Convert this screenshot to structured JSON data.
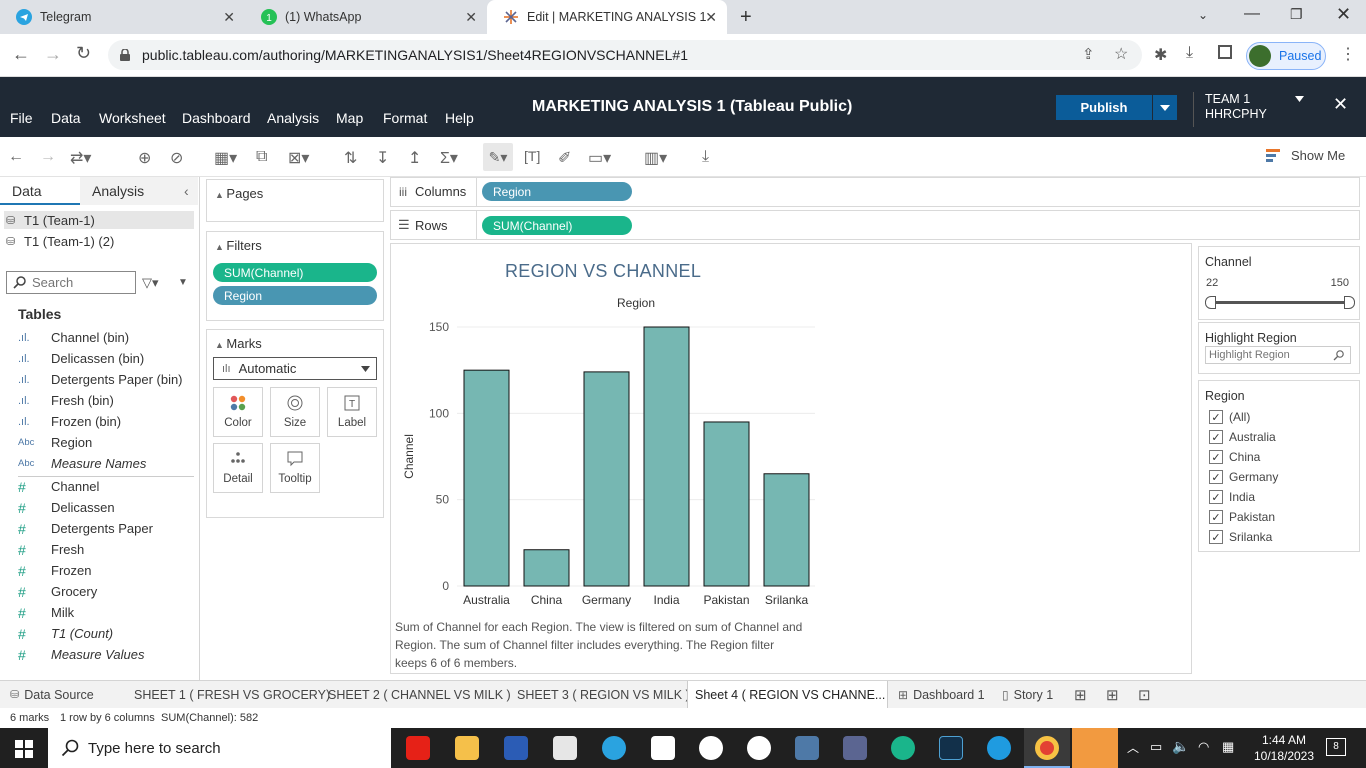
{
  "browser": {
    "tabs": [
      {
        "title": "Telegram",
        "active": false
      },
      {
        "title": "(1) WhatsApp",
        "active": false
      },
      {
        "title": "Edit | MARKETING ANALYSIS 1",
        "active": true
      }
    ],
    "url": "public.tableau.com/authoring/MARKETINGANALYSIS1/Sheet4REGIONVSCHANNEL#1",
    "profile_status": "Paused"
  },
  "app": {
    "menu": [
      "File",
      "Data",
      "Worksheet",
      "Dashboard",
      "Analysis",
      "Map",
      "Format",
      "Help"
    ],
    "title": "MARKETING ANALYSIS 1 (Tableau Public)",
    "publish_label": "Publish",
    "team_line1": "TEAM 1",
    "team_line2": "HHRCPHY",
    "show_me": "Show Me"
  },
  "data_pane": {
    "tab_data": "Data",
    "tab_analysis": "Analysis",
    "sources": [
      "T1 (Team-1)",
      "T1 (Team-1) (2)"
    ],
    "search_placeholder": "Search",
    "tables_label": "Tables",
    "dimensions": [
      {
        "icon": ".ıl.",
        "name": "Channel (bin)",
        "italic": false
      },
      {
        "icon": ".ıl.",
        "name": "Delicassen (bin)",
        "italic": false
      },
      {
        "icon": ".ıl.",
        "name": "Detergents Paper (bin)",
        "italic": false
      },
      {
        "icon": ".ıl.",
        "name": "Fresh (bin)",
        "italic": false
      },
      {
        "icon": ".ıl.",
        "name": "Frozen (bin)",
        "italic": false
      },
      {
        "icon": "Abc",
        "name": "Region",
        "italic": false
      },
      {
        "icon": "Abc",
        "name": "Measure Names",
        "italic": true
      }
    ],
    "measures": [
      {
        "name": "Channel",
        "italic": false
      },
      {
        "name": "Delicassen",
        "italic": false
      },
      {
        "name": "Detergents Paper",
        "italic": false
      },
      {
        "name": "Fresh",
        "italic": false
      },
      {
        "name": "Frozen",
        "italic": false
      },
      {
        "name": "Grocery",
        "italic": false
      },
      {
        "name": "Milk",
        "italic": false
      },
      {
        "name": "T1 (Count)",
        "italic": true
      },
      {
        "name": "Measure Values",
        "italic": true
      }
    ]
  },
  "shelves": {
    "pages_label": "Pages",
    "filters_label": "Filters",
    "filters": [
      "SUM(Channel)",
      "Region"
    ],
    "marks_label": "Marks",
    "mark_type": "Automatic",
    "mark_buttons": [
      "Color",
      "Size",
      "Label",
      "Detail",
      "Tooltip"
    ],
    "columns_label": "Columns",
    "columns_pill": "Region",
    "rows_label": "Rows",
    "rows_pill": "SUM(Channel)"
  },
  "chart_data": {
    "type": "bar",
    "title": "REGION VS CHANNEL",
    "xlabel": "Region",
    "ylabel": "Channel",
    "categories": [
      "Australia",
      "China",
      "Germany",
      "India",
      "Pakistan",
      "Srilanka"
    ],
    "values": [
      125,
      21,
      124,
      150,
      95,
      65
    ],
    "ylim": [
      0,
      150
    ],
    "yticks": [
      0,
      50,
      100,
      150
    ],
    "bar_color": "#76b7b2",
    "grid": true
  },
  "caption": "Sum of Channel for each Region. The view is filtered on sum of Channel and Region. The sum of Channel filter includes everything. The Region filter keeps 6 of 6 members.",
  "right_panel": {
    "channel_title": "Channel",
    "channel_min": "22",
    "channel_max": "150",
    "highlight_title": "Highlight Region",
    "highlight_placeholder": "Highlight Region",
    "region_title": "Region",
    "region_items": [
      "(All)",
      "Australia",
      "China",
      "Germany",
      "India",
      "Pakistan",
      "Srilanka"
    ]
  },
  "sheet_tabs": {
    "data_source": "Data Source",
    "tabs": [
      "SHEET 1 ( FRESH VS GROCERY)",
      "SHEET 2 ( CHANNEL VS MILK )",
      "SHEET 3 ( REGION VS MILK )",
      "Sheet 4 ( REGION VS CHANNE...",
      "Dashboard 1",
      "Story 1"
    ]
  },
  "status": {
    "marks": "6 marks",
    "rows_cols": "1 row by 6 columns",
    "sum": "SUM(Channel): 582"
  },
  "taskbar": {
    "search_placeholder": "Type here to search",
    "time": "1:44 AM",
    "date": "10/18/2023",
    "notifications": "8"
  }
}
